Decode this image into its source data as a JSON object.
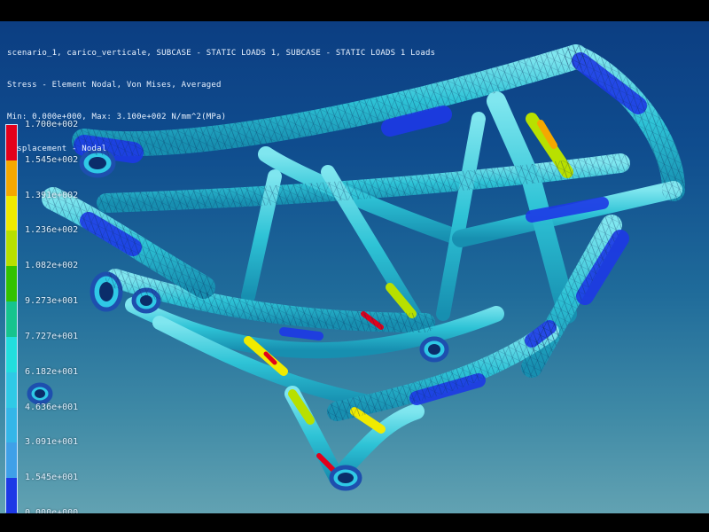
{
  "header": {
    "line1": "scenario_1, carico_verticale, SUBCASE - STATIC LOADS 1, SUBCASE - STATIC LOADS 1 Loads",
    "line2": "Stress - Element Nodal, Von Mises, Averaged",
    "line3": "Min: 0.000e+000, Max: 3.100e+002 N/mm^2(MPa)",
    "line4": "Displacement - Nodal"
  },
  "legend": {
    "labels": [
      "1.700e+002",
      "1.545e+002",
      "1.391e+002",
      "1.236e+002",
      "1.082e+002",
      "9.273e+001",
      "7.727e+001",
      "6.182e+001",
      "4.636e+001",
      "3.091e+001",
      "1.545e+001",
      "0.000e+000"
    ],
    "colors": [
      "#e3001b",
      "#f5a800",
      "#f0ea00",
      "#b8e000",
      "#33c200",
      "#16c48e",
      "#22dede",
      "#2fc9e6",
      "#34b6e8",
      "#3fa0e8",
      "#1d39e6"
    ]
  },
  "colors": {
    "background_top": "#0c3e82",
    "background_bottom": "#62a2b2",
    "tube_base": "#2ec3d6",
    "tube_low": "#1d39e6",
    "tube_high": "#e3001b"
  }
}
